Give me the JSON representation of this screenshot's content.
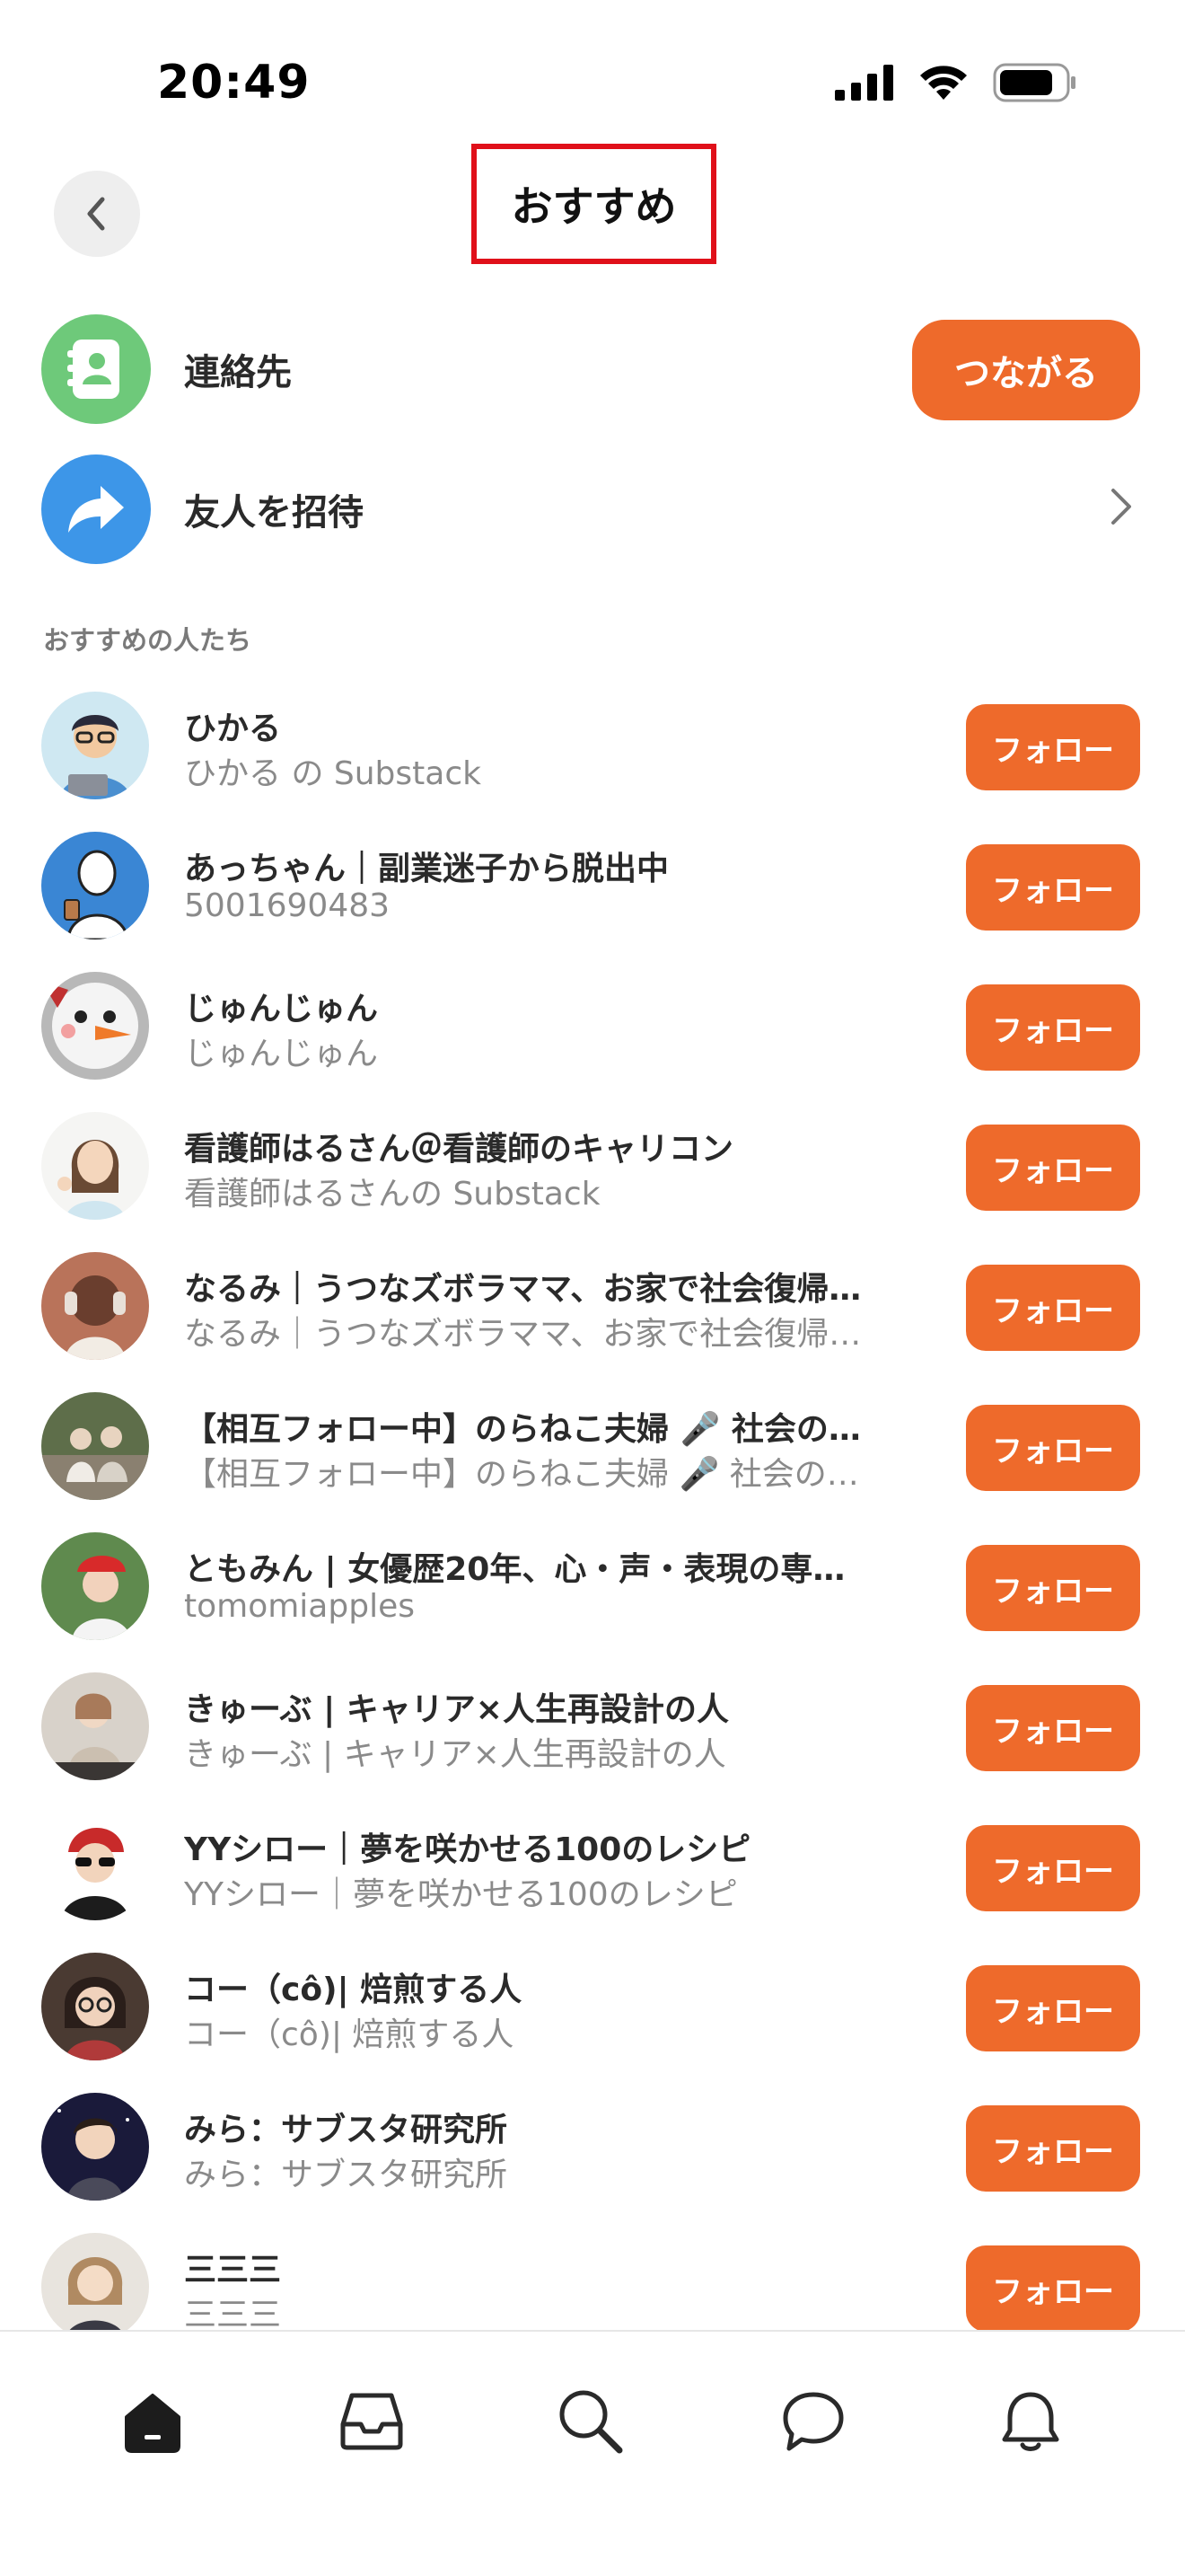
{
  "status_bar": {
    "time": "20:49"
  },
  "header": {
    "title": "おすすめ"
  },
  "contacts": {
    "label": "連絡先",
    "button_label": "つながる",
    "icon": "contact-book-icon"
  },
  "invite": {
    "label": "友人を招待",
    "icon": "share-arrow-icon"
  },
  "section": {
    "title": "おすすめの人たち"
  },
  "users": [
    {
      "name": "ひかる",
      "sub": "ひかる の Substack",
      "follow": "フォロー"
    },
    {
      "name": "あっちゃん｜副業迷子から脱出中",
      "sub": "5001690483",
      "follow": "フォロー"
    },
    {
      "name": "じゅんじゅん",
      "sub": "じゅんじゅん",
      "follow": "フォロー"
    },
    {
      "name": "看護師はるさん＠看護師のキャリコン",
      "sub": "看護師はるさんの Substack",
      "follow": "フォロー"
    },
    {
      "name": "なるみ｜うつなズボラママ、お家で社会復帰…",
      "sub": "なるみ｜うつなズボラママ、お家で社会復帰…",
      "follow": "フォロー"
    },
    {
      "name": "【相互フォロー中】のらねこ夫婦 🎤 社会の普…",
      "sub": "【相互フォロー中】のらねこ夫婦 🎤 社会の普…",
      "follow": "フォロー"
    },
    {
      "name": "ともみん | 女優歴20年、心・声・表現の専…",
      "sub": "tomomiapples",
      "follow": "フォロー"
    },
    {
      "name": "きゅーぶ | キャリア×人生再設計の人",
      "sub": "きゅーぶ | キャリア×人生再設計の人",
      "follow": "フォロー"
    },
    {
      "name": "YYシロー｜夢を咲かせる100のレシピ",
      "sub": "YYシロー｜夢を咲かせる100のレシピ",
      "follow": "フォロー"
    },
    {
      "name": "コー（cô)| 焙煎する人",
      "sub": "コー（cô)| 焙煎する人",
      "follow": "フォロー"
    },
    {
      "name": "みら：サブスタ研究所",
      "sub": "みら：サブスタ研究所",
      "follow": "フォロー"
    },
    {
      "name": "三三三",
      "sub": "三三三",
      "follow": "フォロー"
    }
  ],
  "tabs": [
    {
      "icon": "home-icon"
    },
    {
      "icon": "inbox-icon"
    },
    {
      "icon": "search-icon"
    },
    {
      "icon": "chat-icon"
    },
    {
      "icon": "bell-icon"
    }
  ],
  "colors": {
    "accent": "#ee6a2b",
    "contacts_green": "#6ec97a",
    "invite_blue": "#3d96e8",
    "highlight_red": "#e0101a"
  }
}
